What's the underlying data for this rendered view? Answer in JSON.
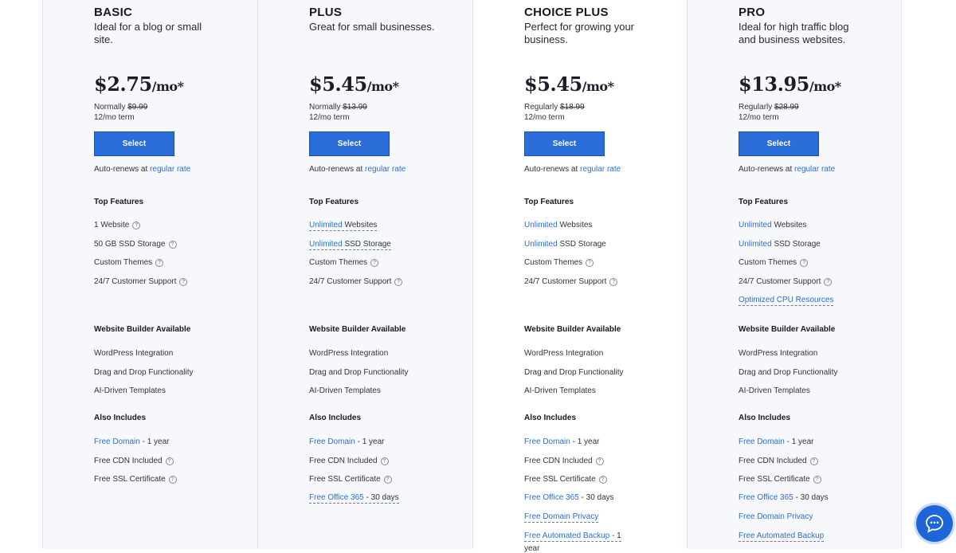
{
  "plans": [
    {
      "name": "BASIC",
      "description": "Ideal for a blog or small site.",
      "price": "$2.75",
      "price_unit": "/mo*",
      "normal_label": "Normally",
      "normal_price": "$9.99",
      "term": "12/mo term",
      "select_label": "Select",
      "autorenew_text": "Auto-renews at",
      "autorenew_link": "regular rate",
      "top_features_title": "Top Features",
      "top_features": [
        {
          "pre": "",
          "link": "",
          "text": "1 Website",
          "info": true
        },
        {
          "pre": "",
          "link": "",
          "text": "50 GB SSD Storage",
          "info": true
        },
        {
          "pre": "",
          "link": "",
          "text": "Custom Themes",
          "info": true
        },
        {
          "pre": "",
          "link": "",
          "text": "24/7 Customer Support",
          "info": true
        }
      ],
      "builder_title": "Website Builder Available",
      "builder_features": [
        "WordPress Integration",
        "Drag and Drop Functionality",
        "AI-Driven Templates"
      ],
      "also_title": "Also Includes",
      "also_features": [
        {
          "link": "Free Domain",
          "text": " - 1 year",
          "info": false,
          "dotted": false
        },
        {
          "link": "",
          "text": "Free CDN Included",
          "info": true,
          "dotted": false
        },
        {
          "link": "",
          "text": "Free SSL Certificate",
          "info": true,
          "dotted": false
        }
      ]
    },
    {
      "name": "PLUS",
      "description": "Great for small businesses.",
      "price": "$5.45",
      "price_unit": "/mo*",
      "normal_label": "Normally",
      "normal_price": "$13.99",
      "term": "12/mo term",
      "select_label": "Select",
      "autorenew_text": "Auto-renews at",
      "autorenew_link": "regular rate",
      "top_features_title": "Top Features",
      "top_features": [
        {
          "pre": "",
          "link": "Unlimited",
          "text": " Websites",
          "info": false,
          "dotted": true
        },
        {
          "pre": "",
          "link": "Unlimited",
          "text": " SSD Storage",
          "info": false,
          "dotted": true
        },
        {
          "pre": "",
          "link": "",
          "text": "Custom Themes",
          "info": true
        },
        {
          "pre": "",
          "link": "",
          "text": "24/7 Customer Support",
          "info": true
        }
      ],
      "builder_title": "Website Builder Available",
      "builder_features": [
        "WordPress Integration",
        "Drag and Drop Functionality",
        "AI-Driven Templates"
      ],
      "also_title": "Also Includes",
      "also_features": [
        {
          "link": "Free Domain",
          "text": " - 1 year",
          "info": false,
          "dotted": false
        },
        {
          "link": "",
          "text": "Free CDN Included",
          "info": true,
          "dotted": false
        },
        {
          "link": "",
          "text": "Free SSL Certificate",
          "info": true,
          "dotted": false
        },
        {
          "link": "Free Office 365",
          "text": " - 30 days",
          "info": false,
          "dotted": true
        }
      ]
    },
    {
      "name": "CHOICE PLUS",
      "description": "Perfect for growing your business.",
      "price": "$5.45",
      "price_unit": "/mo*",
      "normal_label": "Regularly",
      "normal_price": "$18.99",
      "term": "12/mo term",
      "select_label": "Select",
      "autorenew_text": "Auto-renews at",
      "autorenew_link": "regular rate",
      "top_features_title": "Top Features",
      "top_features": [
        {
          "pre": "",
          "link": "Unlimited",
          "text": " Websites",
          "info": false
        },
        {
          "pre": "",
          "link": "Unlimited",
          "text": " SSD Storage",
          "info": false
        },
        {
          "pre": "",
          "link": "",
          "text": "Custom Themes",
          "info": true
        },
        {
          "pre": "",
          "link": "",
          "text": "24/7 Customer Support",
          "info": true
        }
      ],
      "builder_title": "Website Builder Available",
      "builder_features": [
        "WordPress Integration",
        "Drag and Drop Functionality",
        "AI-Driven Templates"
      ],
      "also_title": "Also Includes",
      "also_features": [
        {
          "link": "Free Domain",
          "text": " - 1 year",
          "info": false,
          "dotted": false
        },
        {
          "link": "",
          "text": "Free CDN Included",
          "info": true,
          "dotted": false
        },
        {
          "link": "",
          "text": "Free SSL Certificate",
          "info": true,
          "dotted": false
        },
        {
          "link": "Free Office 365",
          "text": " - 30 days",
          "info": false,
          "dotted": false
        },
        {
          "link": "Free Domain Privacy",
          "text": "",
          "info": false,
          "dotted": true
        },
        {
          "link": "Free Automated Backup",
          "text": " - 1",
          "info": false,
          "dotted": true
        },
        {
          "link": "",
          "text": "year",
          "info": false,
          "dotted": false
        }
      ]
    },
    {
      "name": "PRO",
      "description": "Ideal for high traffic blog and business websites.",
      "price": "$13.95",
      "price_unit": "/mo*",
      "normal_label": "Regularly",
      "normal_price": "$28.99",
      "term": "12/mo term",
      "select_label": "Select",
      "autorenew_text": "Auto-renews at",
      "autorenew_link": "regular rate",
      "top_features_title": "Top Features",
      "top_features": [
        {
          "pre": "",
          "link": "Unlimited",
          "text": " Websites",
          "info": false
        },
        {
          "pre": "",
          "link": "Unlimited",
          "text": " SSD Storage",
          "info": false
        },
        {
          "pre": "",
          "link": "",
          "text": "Custom Themes",
          "info": true
        },
        {
          "pre": "",
          "link": "",
          "text": "24/7 Customer Support",
          "info": true
        },
        {
          "pre": "",
          "link": "Optimized CPU Resources",
          "text": "",
          "info": false,
          "dotted": true
        }
      ],
      "builder_title": "Website Builder Available",
      "builder_features": [
        "WordPress Integration",
        "Drag and Drop Functionality",
        "AI-Driven Templates"
      ],
      "also_title": "Also Includes",
      "also_features": [
        {
          "link": "Free Domain",
          "text": " - 1 year",
          "info": false,
          "dotted": false
        },
        {
          "link": "",
          "text": "Free CDN Included",
          "info": true,
          "dotted": false
        },
        {
          "link": "",
          "text": "Free SSL Certificate",
          "info": true,
          "dotted": false
        },
        {
          "link": "Free Office 365",
          "text": " - 30 days",
          "info": false,
          "dotted": false
        },
        {
          "link": "Free Domain Privacy",
          "text": "",
          "info": false,
          "dotted": false
        },
        {
          "link": "Free Automated Backup",
          "text": "",
          "info": false,
          "dotted": true
        }
      ]
    }
  ],
  "chat": {
    "icon": "chat-bubble-icon",
    "color": "#1e66d8"
  },
  "colors": {
    "accent": "#2b6ed9",
    "button_border": "#1c4fae",
    "column_bg": "#f6f8fb"
  }
}
